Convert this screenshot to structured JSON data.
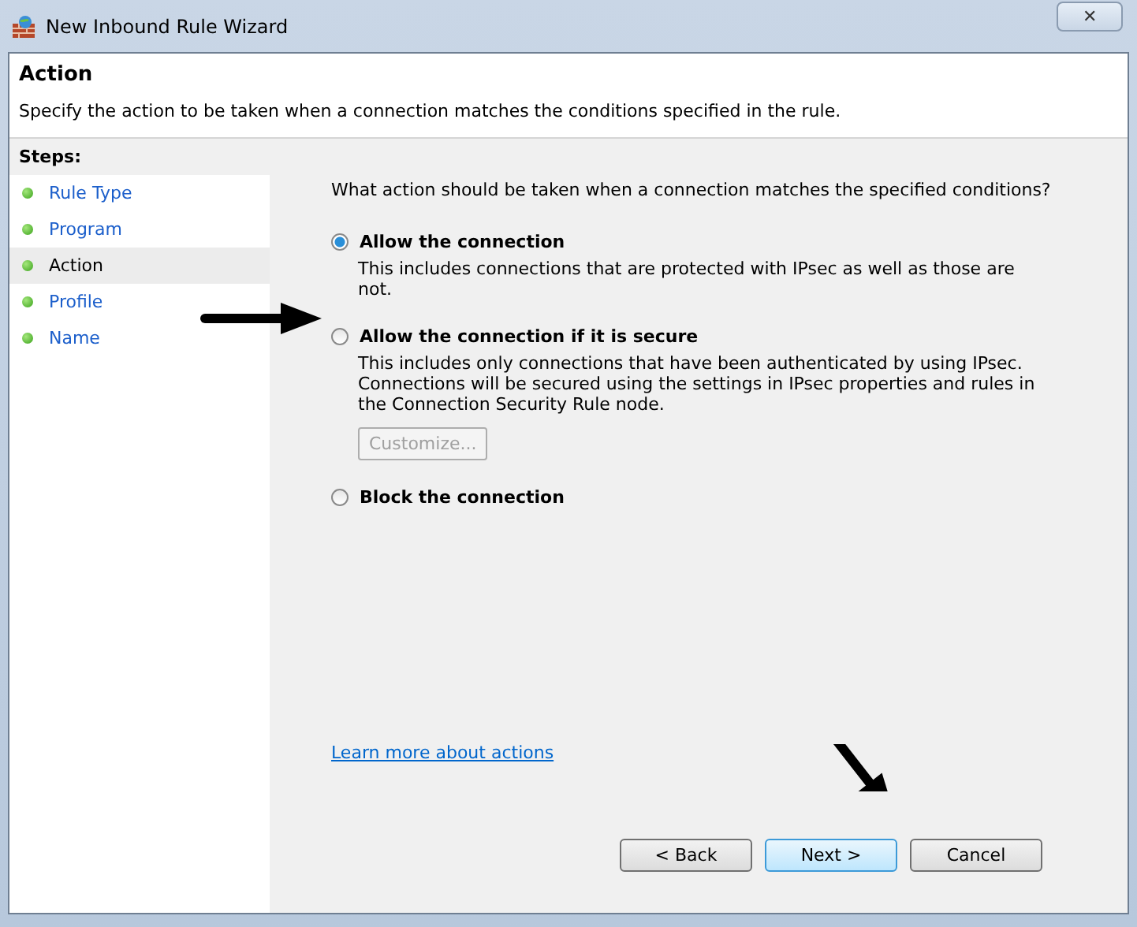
{
  "window": {
    "title": "New Inbound Rule Wizard",
    "close": "✕"
  },
  "header": {
    "title": "Action",
    "description": "Specify the action to be taken when a connection matches the conditions specified in the rule."
  },
  "steps": {
    "heading": "Steps:",
    "items": [
      {
        "label": "Rule Type",
        "selected": false
      },
      {
        "label": "Program",
        "selected": false
      },
      {
        "label": "Action",
        "selected": true
      },
      {
        "label": "Profile",
        "selected": false
      },
      {
        "label": "Name",
        "selected": false
      }
    ]
  },
  "question": "What action should be taken when a connection matches the specified conditions?",
  "options": [
    {
      "label": "Allow the connection",
      "selected": true,
      "description": "This includes connections that are protected with IPsec as well as those are not."
    },
    {
      "label": "Allow the connection if it is secure",
      "selected": false,
      "description": "This includes only connections that have been authenticated by using IPsec.  Connections will be secured using the settings in IPsec properties and rules in the Connection Security Rule node.",
      "button": {
        "label": "Customize...",
        "disabled": true
      }
    },
    {
      "label": "Block the connection",
      "selected": false
    }
  ],
  "link": "Learn more about actions",
  "buttons": [
    {
      "label": "< Back",
      "default": false
    },
    {
      "label": "Next >",
      "default": true
    },
    {
      "label": "Cancel",
      "default": false
    }
  ]
}
